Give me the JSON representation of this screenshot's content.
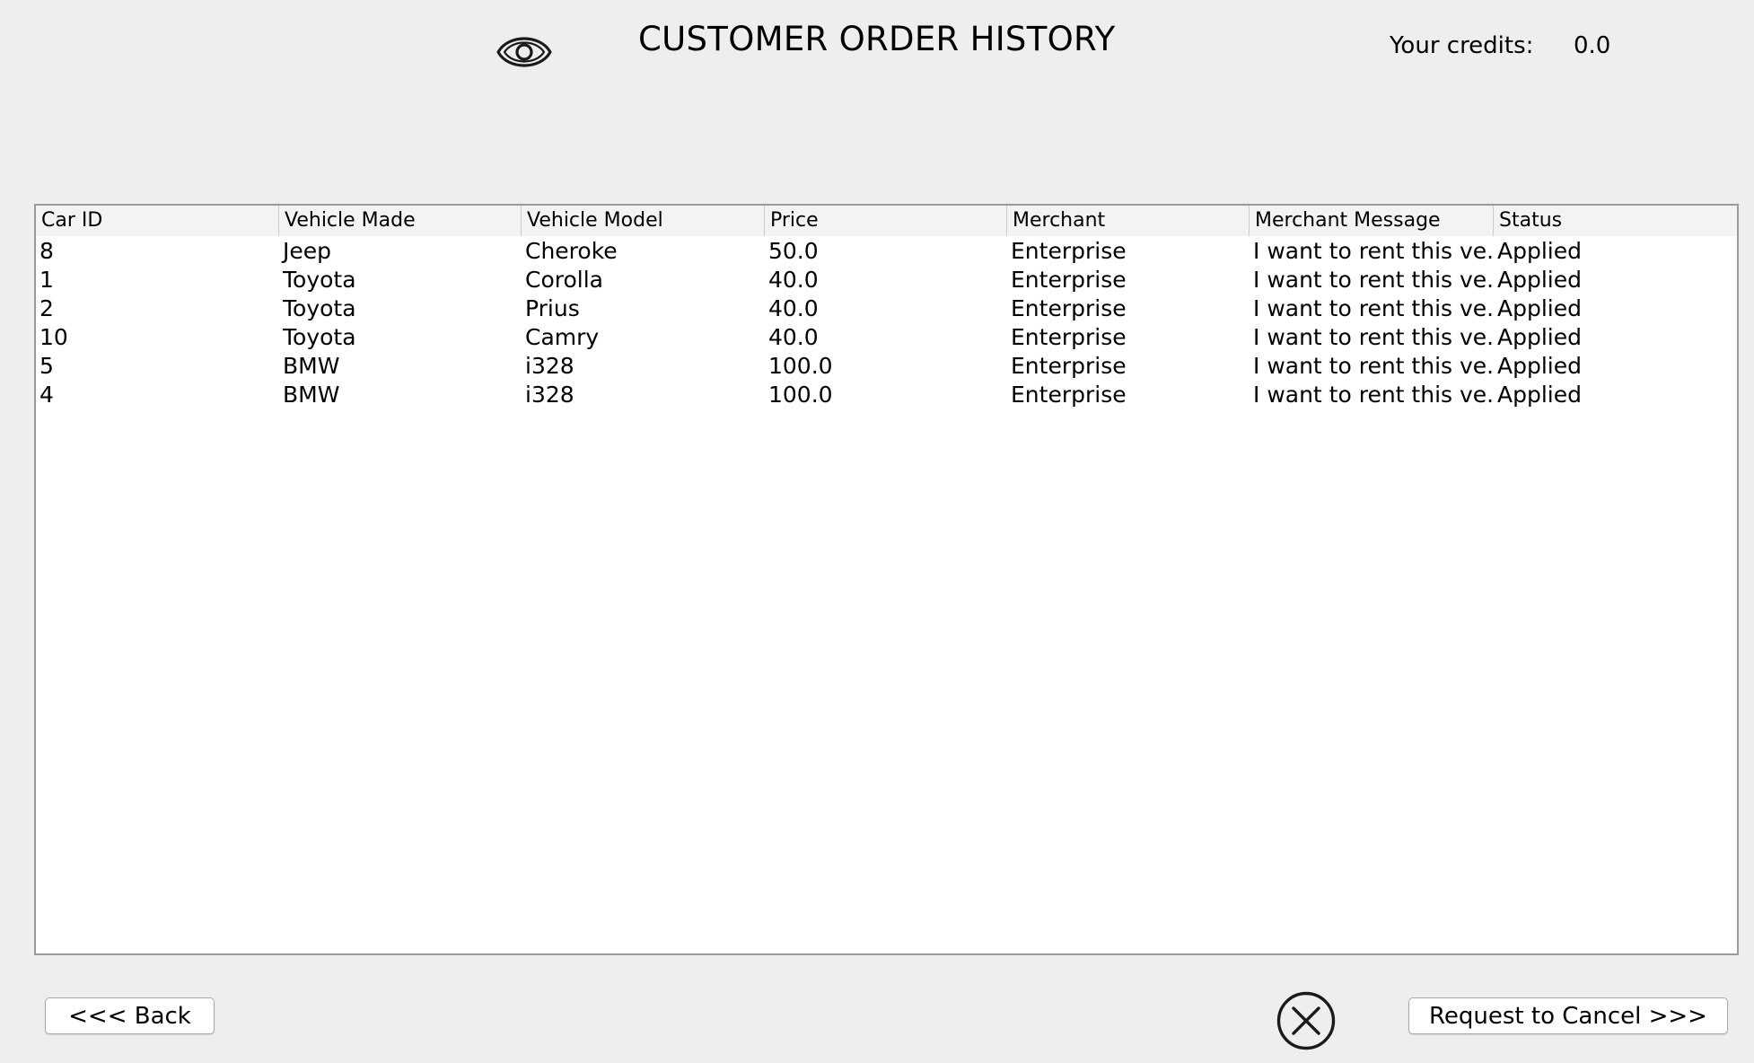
{
  "header": {
    "icon": "eye-icon",
    "title": "CUSTOMER ORDER HISTORY",
    "credits_label": "Your credits:",
    "credits_value": "0.0"
  },
  "table": {
    "columns": [
      "Car ID",
      "Vehicle Made",
      "Vehicle Model",
      "Price",
      "Merchant",
      "Merchant Message",
      "Status"
    ],
    "rows": [
      [
        "8",
        "Jeep",
        "Cheroke",
        "50.0",
        "Enterprise",
        "I want to rent this ve...",
        "Applied"
      ],
      [
        "1",
        "Toyota",
        "Corolla",
        "40.0",
        "Enterprise",
        "I want to rent this ve...",
        "Applied"
      ],
      [
        "2",
        "Toyota",
        "Prius",
        "40.0",
        "Enterprise",
        "I want to rent this ve...",
        "Applied"
      ],
      [
        "10",
        "Toyota",
        "Camry",
        "40.0",
        "Enterprise",
        "I want to rent this ve...",
        "Applied"
      ],
      [
        "5",
        "BMW",
        "i328",
        "100.0",
        "Enterprise",
        "I want to rent this ve...",
        "Applied"
      ],
      [
        "4",
        "BMW",
        "i328",
        "100.0",
        "Enterprise",
        "I want to rent this ve...",
        "Applied"
      ]
    ]
  },
  "footer": {
    "back_label": "<<< Back",
    "cancel_icon": "cancel-circle-x-icon",
    "request_cancel_label": "Request to Cancel >>>"
  }
}
